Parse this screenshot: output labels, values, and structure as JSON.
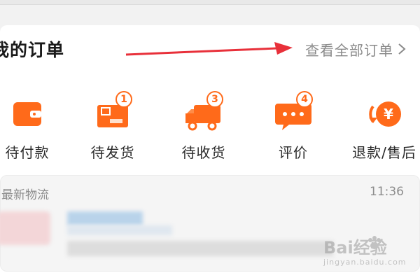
{
  "orders": {
    "title": "我的订单",
    "view_all_label": "查看全部订单"
  },
  "statuses": [
    {
      "label": "待付款",
      "icon": "wallet-icon"
    },
    {
      "label": "待发货",
      "icon": "package-icon",
      "badge": "1"
    },
    {
      "label": "待收货",
      "icon": "truck-icon",
      "badge": "3"
    },
    {
      "label": "评价",
      "icon": "comment-icon",
      "badge": "4"
    },
    {
      "label": "退款/售后",
      "icon": "refund-yen-icon"
    }
  ],
  "logistics": {
    "title": "最新物流",
    "time": "11:36"
  },
  "watermark": {
    "brand": "Bai经验",
    "url": "jingyan.baidu.com"
  },
  "colors": {
    "accent": "#ff6a1a",
    "arrow": "#e8303a",
    "muted_text": "#8a8a8a"
  }
}
